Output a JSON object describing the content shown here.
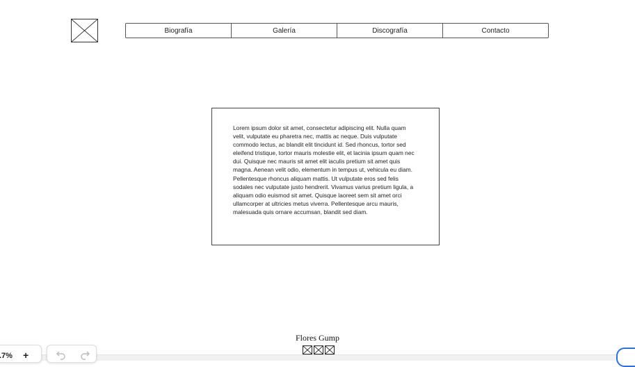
{
  "nav": {
    "items": [
      "Biografía",
      "Galería",
      "Discografía",
      "Contacto"
    ]
  },
  "content": {
    "text": "Lorem ipsum dolor sit amet, consectetur adipiscing elit. Nulla quam velit, vulputate eu pharetra nec, mattis ac neque. Duis vulputate commodo lectus, ac blandit elit tincidunt id. Sed rhoncus, tortor sed eleifend tristique, tortor mauris molestie elit, et lacinia ipsum quam nec dui. Quisque nec mauris sit amet elit iaculis pretium sit amet quis magna. Aenean velit odio, elementum in tempus ut, vehicula eu diam. Pellentesque rhoncus aliquam mattis. Ut vulputate eros sed felis sodales nec vulputate justo hendrerit. Vivamus varius pretium ligula, a aliquam odio euismod sit amet. Quisque laoreet sem sit amet orci ullamcorper at ultricies metus viverra. Pellentesque arcu mauris, malesuada quis ornare accumsan, blandit sed diam."
  },
  "footer": {
    "name": "Flores Gump",
    "icons": [
      "image-placeholder-icon",
      "image-placeholder-icon",
      "image-placeholder-icon"
    ]
  },
  "toolbar": {
    "zoom_value": ".7%",
    "zoom_in_label": "+",
    "undo_icon": "undo-icon",
    "redo_icon": "redo-icon"
  },
  "colors": {
    "accent": "#2f6fd6",
    "border": "#555555"
  }
}
